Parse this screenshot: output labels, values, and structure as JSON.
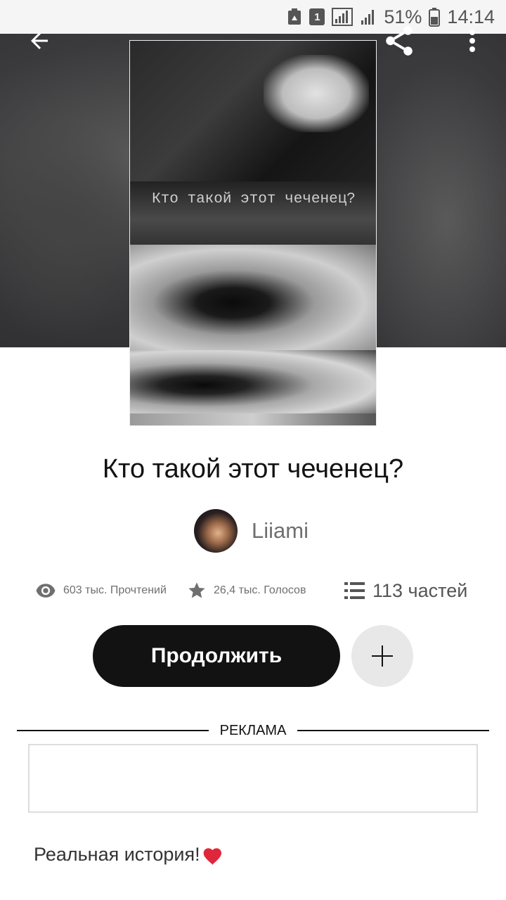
{
  "status_bar": {
    "battery_percent": "51%",
    "time": "14:14",
    "sim_label": "1",
    "icons": [
      "recycle-icon",
      "sim-1-icon",
      "signal-icon",
      "signal-icon-2",
      "battery-icon"
    ]
  },
  "header": {
    "back_icon": "arrow-left-icon",
    "share_icon": "share-icon",
    "more_icon": "more-vertical-icon"
  },
  "cover": {
    "text": "Кто такой этот чеченец?"
  },
  "book": {
    "title": "Кто такой этот чеченец?",
    "author": "Liiami"
  },
  "stats": {
    "reads": "603 тыс. Прочтений",
    "votes": "26,4 тыс. Голосов",
    "parts": "113 частей"
  },
  "actions": {
    "continue_label": "Продолжить",
    "add_icon": "plus-icon"
  },
  "ad": {
    "label": "РЕКЛАМА"
  },
  "description": {
    "text": "Реальная история!",
    "emoji_icon": "heart-icon"
  },
  "colors": {
    "primary_button": "#121212",
    "secondary_button": "#e8e8e8",
    "muted_text": "#6f6f6f",
    "heart": "#e0263a"
  }
}
